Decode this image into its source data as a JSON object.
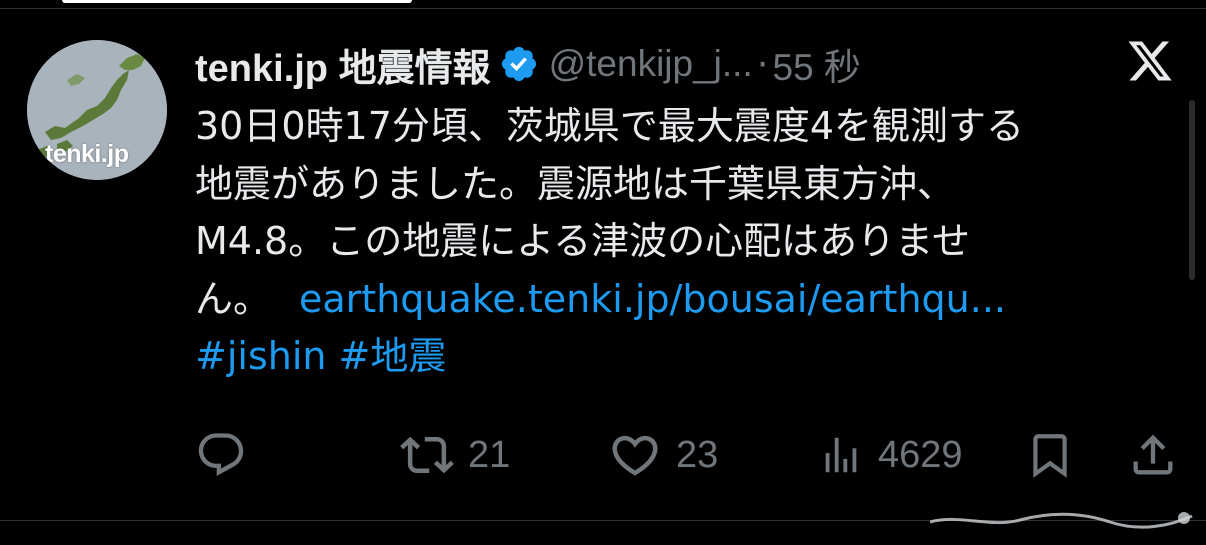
{
  "tweet": {
    "display_name": "tenki.jp 地震情報",
    "handle": "@tenkijp_j...",
    "separator": "·",
    "time": "55 秒",
    "avatar_text": "tenki.jp",
    "text_lines": [
      "30日0時17分頃、茨城県で最大震度4を観測する",
      "地震がありました。震源地は千葉県東方沖、",
      "M4.8。この地震による津波の心配はありませ"
    ],
    "text_last": "ん。",
    "link": "earthquake.tenki.jp/bousai/earthqu...",
    "hashtags": "#jishin #地震",
    "actions": {
      "reply": "",
      "retweet": "21",
      "like": "23",
      "views": "4629"
    }
  },
  "colors": {
    "background": "#000000",
    "text": "#e7e9ea",
    "muted": "#71767b",
    "link": "#1d9bf0",
    "verified": "#1d9bf0"
  },
  "icons": [
    "x-logo-icon",
    "verified-badge-icon",
    "reply-icon",
    "retweet-icon",
    "like-icon",
    "views-icon",
    "bookmark-icon",
    "share-icon"
  ]
}
